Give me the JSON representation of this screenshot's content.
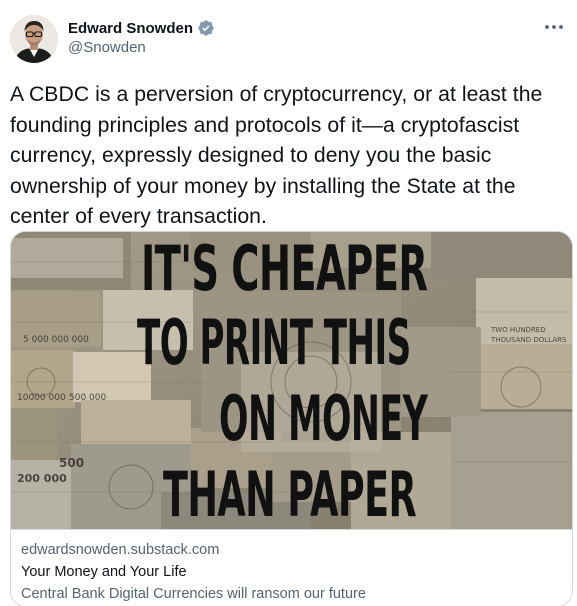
{
  "author": {
    "display_name": "Edward Snowden",
    "handle": "@Snowden",
    "verified": true,
    "avatar_icon": "user-portrait"
  },
  "tweet": {
    "text": "A CBDC is a perversion of cryptocurrency, or at least the founding principles and protocols of it—a cryptofascist currency, expressly designed to deny you the basic ownership of your money by installing the State at the center of every transaction."
  },
  "card": {
    "image_headline": [
      "IT'S CHEAPER",
      "TO PRINT THIS",
      "ON MONEY",
      "THAN PAPER"
    ],
    "domain": "edwardsnowden.substack.com",
    "title": "Your Money and Your Life",
    "description": "Central Bank Digital Currencies will ransom our future"
  },
  "icons": {
    "more": "more-horizontal-icon",
    "verified": "verified-badge-icon"
  },
  "colors": {
    "text_primary": "#0f1419",
    "text_secondary": "#536471",
    "verified_badge": "#829aab",
    "border": "#cfd9de"
  }
}
